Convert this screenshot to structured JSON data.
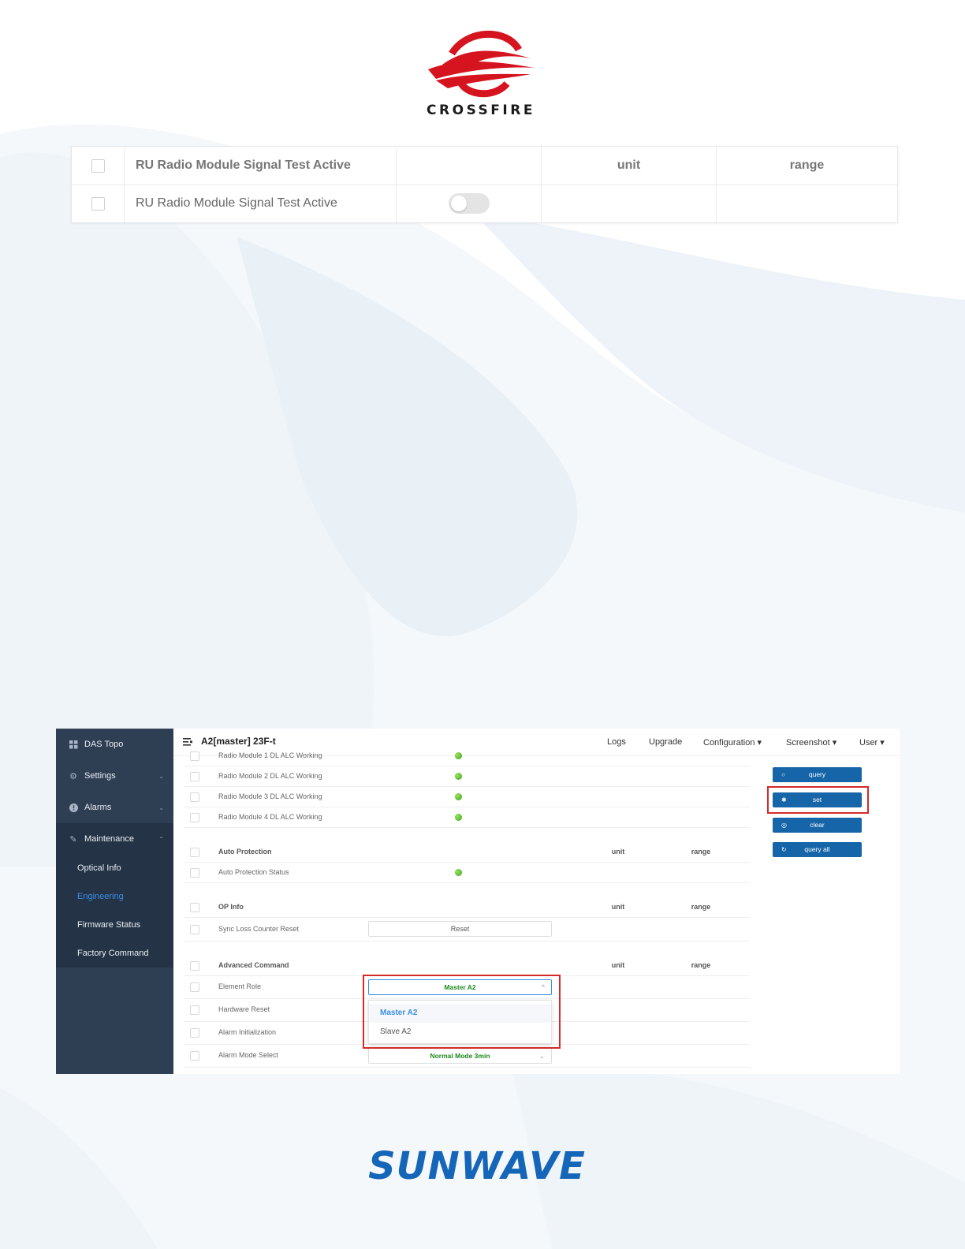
{
  "brand_top": {
    "name": "CROSSFIRE",
    "color": "#d6141f"
  },
  "top_table": {
    "header": {
      "title": "RU Radio Module Signal Test Active",
      "unit": "unit",
      "range": "range"
    },
    "row": {
      "label": "RU Radio Module Signal Test Active",
      "toggle_on": false
    }
  },
  "app": {
    "title": "A2[master] 23F-t",
    "menu_icon": "hamburger-icon",
    "nav": {
      "logs": "Logs",
      "upgrade": "Upgrade",
      "configuration": "Configuration ▾",
      "screenshot": "Screenshot ▾",
      "user": "User ▾"
    },
    "sidebar": {
      "das_topo": "DAS Topo",
      "settings": "Settings",
      "alarms": "Alarms",
      "maintenance": "Maintenance",
      "sub": {
        "optical_info": "Optical Info",
        "engineering": "Engineering",
        "firmware_status": "Firmware Status",
        "factory_command": "Factory Command"
      }
    },
    "grid": {
      "alc_rows": [
        "Radio Module 1 DL ALC Working",
        "Radio Module 2 DL ALC Working",
        "Radio Module 3 DL ALC Working",
        "Radio Module 4 DL ALC Working"
      ],
      "auto_protection": {
        "header": "Auto Protection",
        "unit": "unit",
        "range": "range",
        "status_label": "Auto Protection Status"
      },
      "op_info": {
        "header": "OP Info",
        "unit": "unit",
        "range": "range",
        "sync_label": "Sync Loss Counter Reset",
        "reset_button": "Reset"
      },
      "advanced": {
        "header": "Advanced Command",
        "unit": "unit",
        "range": "range",
        "element_role": "Element Role",
        "element_role_value": "Master A2",
        "hardware_reset": "Hardware Reset",
        "alarm_init": "Alarm Initialization",
        "alarm_mode": "Alarm Mode Select",
        "alarm_mode_value": "Normal Mode 3min",
        "dropdown_options": [
          "Master A2",
          "Slave A2"
        ]
      }
    },
    "actions": {
      "query": "query",
      "set": "set",
      "clear": "clear",
      "query_all": "query all"
    }
  },
  "brand_bottom": {
    "name": "SUNWAVE",
    "color": "#1565b8"
  },
  "colors": {
    "sidebar_bg": "#2e3f54",
    "accent_blue": "#3a8ee6",
    "button_blue": "#1565a8",
    "status_green": "#3aa31a",
    "highlight_red": "#d42a2a"
  }
}
